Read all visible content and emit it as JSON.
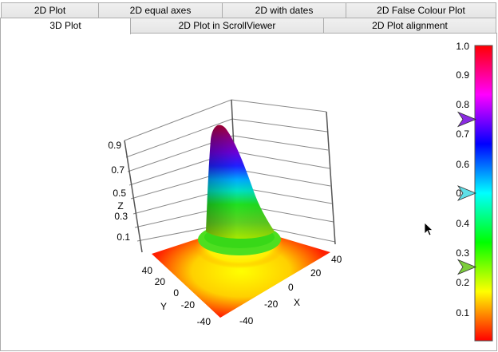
{
  "tabs_back": [
    {
      "label": "2D Plot"
    },
    {
      "label": "2D equal axes"
    },
    {
      "label": "2D with dates"
    },
    {
      "label": "2D False Colour Plot"
    }
  ],
  "tabs_front": [
    {
      "label": "3D Plot",
      "selected": true
    },
    {
      "label": "2D Plot in ScrollViewer"
    },
    {
      "label": "2D Plot alignment"
    }
  ],
  "plot3d": {
    "z_axis_label": "Z",
    "x_axis_label": "X",
    "y_axis_label": "Y",
    "z_ticks": [
      "0.9",
      "0.7",
      "0.5",
      "0.3",
      "0.1"
    ],
    "x_ticks": [
      "40",
      "20",
      "0",
      "-20",
      "-40"
    ],
    "y_ticks": [
      "40",
      "20",
      "0",
      "-20",
      "-40"
    ]
  },
  "colorbar": {
    "ticks": [
      "1.0",
      "0.9",
      "0.8",
      "0.7",
      "0.6",
      "0",
      "0.4",
      "0.3",
      "0.2",
      "0.1"
    ],
    "range": [
      0,
      1
    ],
    "colors": [
      "#ff0000",
      "#ffff00",
      "#00ff00",
      "#00ffff",
      "#0000ff",
      "#ff00ff",
      "#ff0000"
    ],
    "markers": [
      {
        "value": 0.75,
        "color": "#8a2be2"
      },
      {
        "value": 0.5,
        "color": "#5fe0e8"
      },
      {
        "value": 0.25,
        "color": "#7ccd3c"
      }
    ]
  }
}
